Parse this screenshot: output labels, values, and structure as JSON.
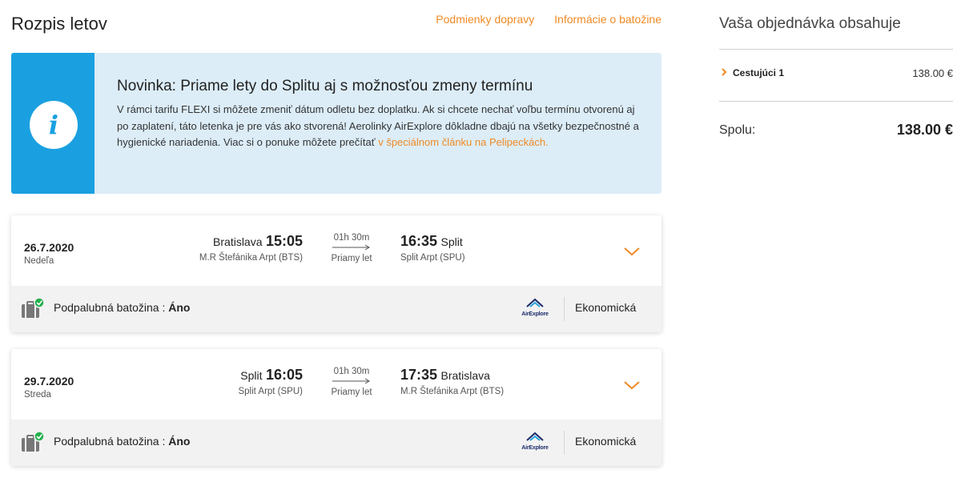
{
  "header": {
    "title": "Rozpis letov",
    "links": [
      "Podmienky dopravy",
      "Informácie o batožine"
    ]
  },
  "notice": {
    "icon": "info-icon",
    "title": "Novinka: Priame lety do Splitu aj s možnosťou zmeny termínu",
    "text": "V rámci tarifu FLEXI si môžete zmeniť dátum odletu bez doplatku. Ak si chcete nechať voľbu termínu otvorenú aj po zaplatení, táto letenka je pre vás ako stvorená! Aerolinky AirExplore dôkladne dbajú na všetky bezpečnostné a hygienické nariadenia. Viac si o ponuke môžete prečítať ",
    "link": "v špeciálnom článku na Pelipeckách.",
    "colors": {
      "accent": "#1aa0e0",
      "background": "#dcedf8"
    }
  },
  "flights": [
    {
      "date": "26.7.2020",
      "day": "Nedeľa",
      "dep_city": "Bratislava",
      "dep_time": "15:05",
      "dep_airport": "M.R Štefánika Arpt (BTS)",
      "duration": "01h 30m",
      "type": "Priamy let",
      "arr_time": "16:35",
      "arr_city": "Split",
      "arr_airport": "Split Arpt (SPU)",
      "baggage_label": "Podpalubná batožina : ",
      "baggage_value": "Áno",
      "airline": "AirExplore",
      "cabin": "Ekonomická"
    },
    {
      "date": "29.7.2020",
      "day": "Streda",
      "dep_city": "Split",
      "dep_time": "16:05",
      "dep_airport": "Split Arpt (SPU)",
      "duration": "01h 30m",
      "type": "Priamy let",
      "arr_time": "17:35",
      "arr_city": "Bratislava",
      "arr_airport": "M.R Štefánika Arpt (BTS)",
      "baggage_label": "Podpalubná batožina : ",
      "baggage_value": "Áno",
      "airline": "AirExplore",
      "cabin": "Ekonomická"
    }
  ],
  "summary": {
    "title": "Vaša objednávka obsahuje",
    "passenger_label": "Cestujúci 1",
    "passenger_price": "138.00 €",
    "total_label": "Spolu:",
    "total_value": "138.00 €"
  },
  "colors": {
    "link": "#f08a24",
    "check": "#22b14c"
  }
}
